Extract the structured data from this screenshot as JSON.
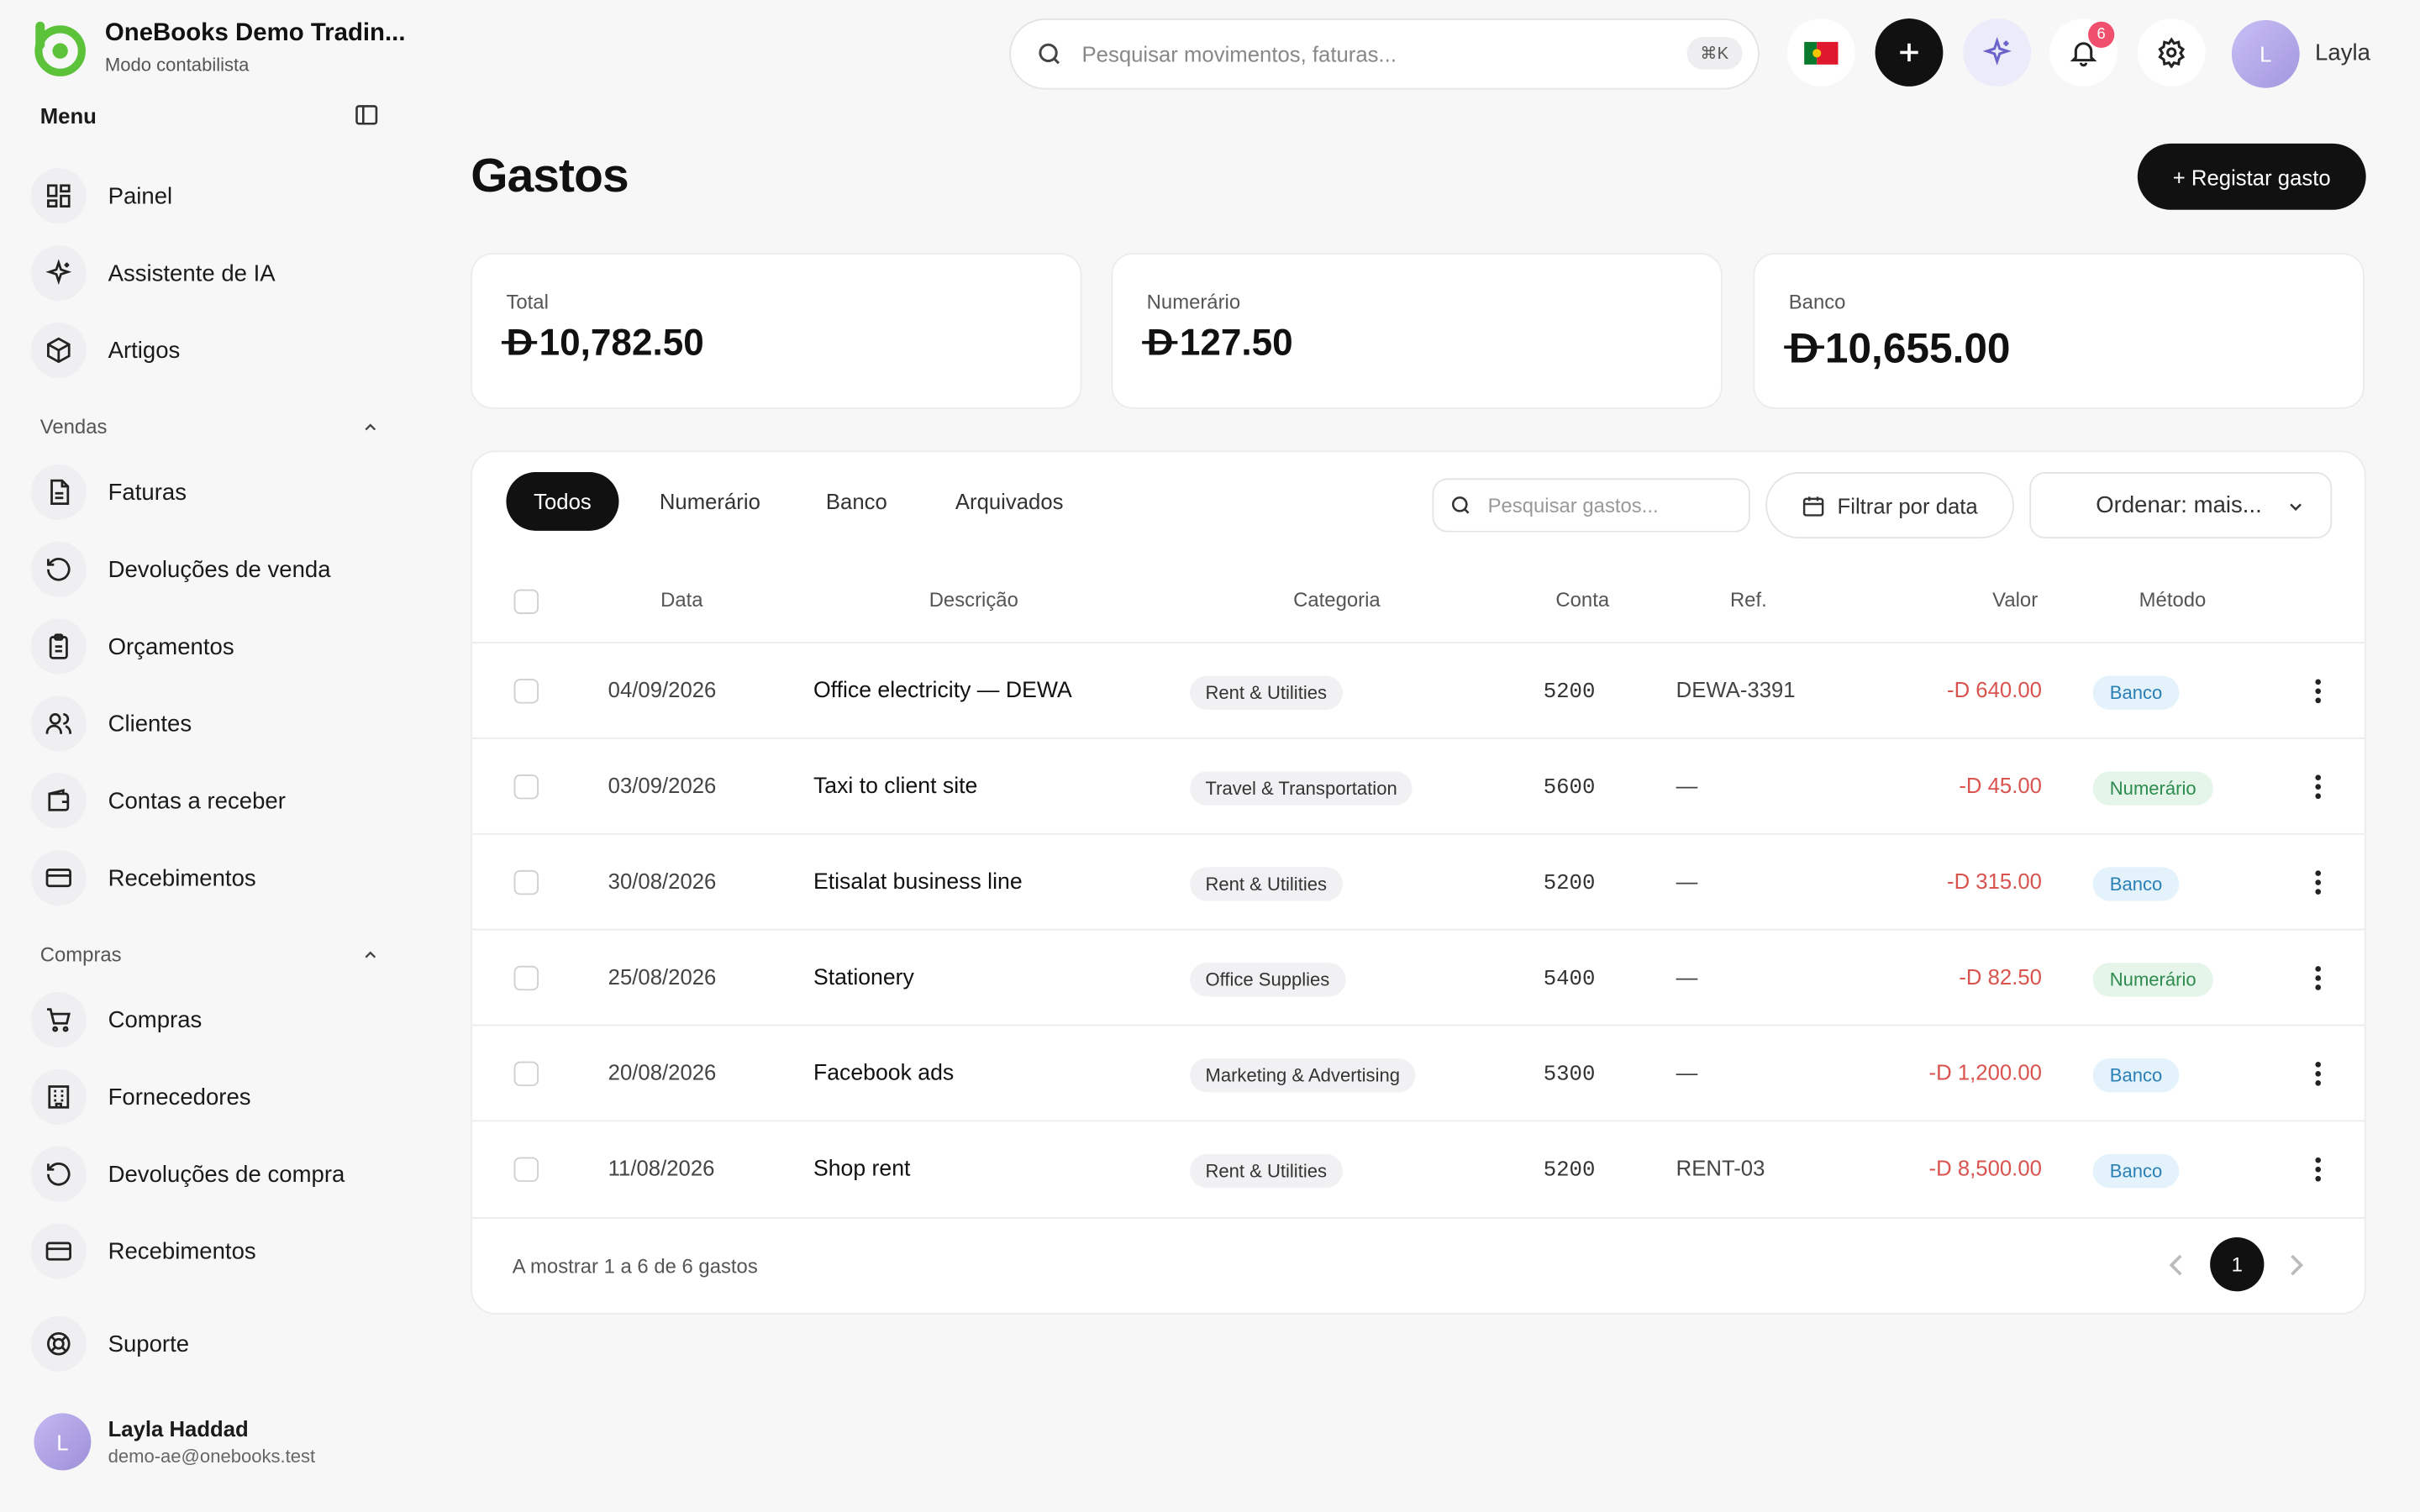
{
  "brand": {
    "name": "OneBooks Demo Tradin...",
    "subtitle": "Modo contabilista",
    "logo_icon": "onebooks-logo",
    "accent": "#5cc23a"
  },
  "sidebar": {
    "menu_label": "Menu",
    "main": [
      {
        "label": "Painel",
        "icon": "dashboard-icon"
      },
      {
        "label": "Assistente de IA",
        "icon": "sparkles-icon"
      },
      {
        "label": "Artigos",
        "icon": "box-icon"
      }
    ],
    "sales_label": "Vendas",
    "sales": [
      {
        "label": "Faturas",
        "icon": "document-icon"
      },
      {
        "label": "Devoluções de venda",
        "icon": "undo-icon"
      },
      {
        "label": "Orçamentos",
        "icon": "clipboard-icon"
      },
      {
        "label": "Clientes",
        "icon": "users-icon"
      },
      {
        "label": "Contas a receber",
        "icon": "wallet-icon"
      },
      {
        "label": "Recebimentos",
        "icon": "card-icon"
      }
    ],
    "purchases_label": "Compras",
    "purchases": [
      {
        "label": "Compras",
        "icon": "cart-icon"
      },
      {
        "label": "Fornecedores",
        "icon": "building-icon"
      },
      {
        "label": "Devoluções de compra",
        "icon": "undo-icon"
      },
      {
        "label": "Recebimentos",
        "icon": "card-icon"
      }
    ],
    "support": {
      "label": "Suporte",
      "icon": "lifebuoy-icon"
    },
    "user": {
      "initial": "L",
      "name": "Layla Haddad",
      "email": "demo-ae@onebooks.test"
    }
  },
  "topbar": {
    "search_placeholder": "Pesquisar movimentos, faturas...",
    "shortcut": "⌘K",
    "notifications_count": "6",
    "user_initial": "L",
    "user_name": "Layla"
  },
  "page": {
    "title": "Gastos",
    "register_button": "+ Registar gasto"
  },
  "currency_symbol": "D",
  "stats": [
    {
      "label": "Total",
      "value": "10,782.50"
    },
    {
      "label": "Numerário",
      "value": "127.50"
    },
    {
      "label": "Banco",
      "value": "10,655.00"
    }
  ],
  "tabs": [
    "Todos",
    "Numerário",
    "Banco",
    "Arquivados"
  ],
  "table_search_placeholder": "Pesquisar gastos...",
  "filter_date_label": "Filtrar por data",
  "sort_label": "Ordenar: mais...",
  "columns": {
    "date": "Data",
    "description": "Descrição",
    "category": "Categoria",
    "account": "Conta",
    "ref": "Ref.",
    "value": "Valor",
    "method": "Método"
  },
  "rows": [
    {
      "date": "04/09/2026",
      "description": "Office electricity — DEWA",
      "category": "Rent & Utilities",
      "account": "5200",
      "ref": "DEWA-3391",
      "value": "-D 640.00",
      "method": "Banco"
    },
    {
      "date": "03/09/2026",
      "description": "Taxi to client site",
      "category": "Travel & Transportation",
      "account": "5600",
      "ref": "—",
      "value": "-D 45.00",
      "method": "Numerário"
    },
    {
      "date": "30/08/2026",
      "description": "Etisalat business line",
      "category": "Rent & Utilities",
      "account": "5200",
      "ref": "—",
      "value": "-D 315.00",
      "method": "Banco"
    },
    {
      "date": "25/08/2026",
      "description": "Stationery",
      "category": "Office Supplies",
      "account": "5400",
      "ref": "—",
      "value": "-D 82.50",
      "method": "Numerário"
    },
    {
      "date": "20/08/2026",
      "description": "Facebook ads",
      "category": "Marketing & Advertising",
      "account": "5300",
      "ref": "—",
      "value": "-D 1,200.00",
      "method": "Banco"
    },
    {
      "date": "11/08/2026",
      "description": "Shop rent",
      "category": "Rent & Utilities",
      "account": "5200",
      "ref": "RENT-03",
      "value": "-D 8,500.00",
      "method": "Banco"
    }
  ],
  "footer": {
    "showing": "A mostrar 1 a 6 de 6 gastos",
    "current_page": "1"
  }
}
